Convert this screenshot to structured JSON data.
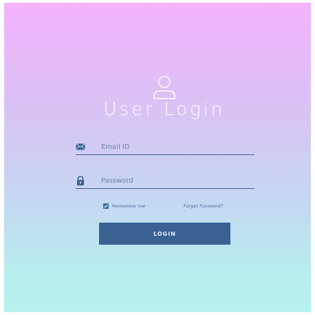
{
  "header": {
    "icon": "user-icon",
    "title": "User Login"
  },
  "form": {
    "email": {
      "icon": "envelope-icon",
      "placeholder": "Email ID",
      "value": ""
    },
    "password": {
      "icon": "lock-icon",
      "placeholder": "Password",
      "value": ""
    },
    "remember": {
      "label": "Remember me",
      "checked": true
    },
    "forgot_label": "Forgot Password?",
    "submit_label": "LOGIN"
  },
  "colors": {
    "gradient_top": "#f4b3fb",
    "gradient_bottom": "#b6f2ee",
    "accent": "#3a6192",
    "text": "#ffffff"
  }
}
